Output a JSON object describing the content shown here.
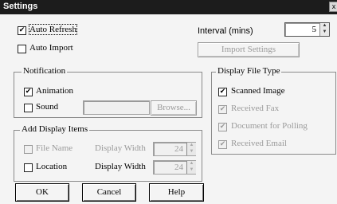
{
  "window": {
    "title": "Settings",
    "close_glyph": "x"
  },
  "auto_refresh": {
    "label": "Auto Refresh",
    "checked": true
  },
  "auto_import": {
    "label": "Auto Import",
    "checked": false
  },
  "interval": {
    "label": "Interval (mins)",
    "value": "5"
  },
  "import_settings_button": {
    "label": "Import Settings",
    "enabled": false
  },
  "notification": {
    "title": "Notification",
    "animation": {
      "label": "Animation",
      "checked": true
    },
    "sound": {
      "label": "Sound",
      "checked": false,
      "path": ""
    },
    "browse_label": "Browse..."
  },
  "display_file_type": {
    "title": "Display File Type",
    "items": [
      {
        "label": "Scanned Image",
        "checked": true,
        "enabled": true
      },
      {
        "label": "Received Fax",
        "checked": true,
        "enabled": false
      },
      {
        "label": "Document for Polling",
        "checked": true,
        "enabled": false
      },
      {
        "label": "Received Email",
        "checked": true,
        "enabled": false
      }
    ]
  },
  "add_display_items": {
    "title": "Add Display Items",
    "file_name": {
      "label": "File Name",
      "checked": false,
      "enabled": false,
      "width_label": "Display Width",
      "width_value": "24"
    },
    "location": {
      "label": "Location",
      "checked": false,
      "enabled": true,
      "width_label": "Display Width",
      "width_value": "24"
    }
  },
  "buttons": {
    "ok": "OK",
    "cancel": "Cancel",
    "help": "Help"
  },
  "check_glyph": "✔"
}
